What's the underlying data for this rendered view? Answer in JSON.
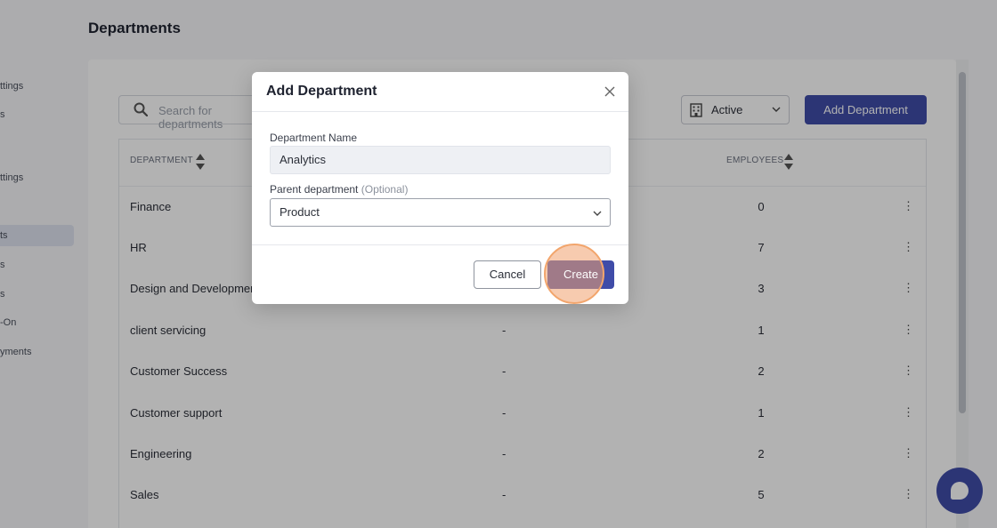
{
  "sidebar": {
    "items": [
      {
        "label": "ttings"
      },
      {
        "label": "s"
      },
      {
        "label": "ttings"
      },
      {
        "label": "ts"
      },
      {
        "label": "s"
      },
      {
        "label": "s"
      },
      {
        "label": "-On"
      },
      {
        "label": "yments"
      }
    ]
  },
  "page": {
    "title": "Departments"
  },
  "toolbar": {
    "search_placeholder": "Search for departments",
    "status_value": "Active",
    "add_label": "Add Department"
  },
  "table": {
    "headers": {
      "department": "DEPARTMENT",
      "employees": "EMPLOYEES"
    },
    "rows": [
      {
        "name": "Finance",
        "parent": "",
        "employees": "0"
      },
      {
        "name": "HR",
        "parent": "",
        "employees": "7"
      },
      {
        "name": "Design and Development",
        "parent": "",
        "employees": "3"
      },
      {
        "name": "client servicing",
        "parent": "-",
        "employees": "1"
      },
      {
        "name": "Customer Success",
        "parent": "-",
        "employees": "2"
      },
      {
        "name": "Customer support",
        "parent": "-",
        "employees": "1"
      },
      {
        "name": "Engineering",
        "parent": "-",
        "employees": "2"
      },
      {
        "name": "Sales",
        "parent": "-",
        "employees": "5"
      }
    ],
    "kebab": "⋮"
  },
  "modal": {
    "title": "Add Department",
    "name_label": "Department Name",
    "name_value": "Analytics",
    "parent_label": "Parent department",
    "parent_optional": "(Optional)",
    "parent_value": "Product",
    "cancel_label": "Cancel",
    "create_label": "Create"
  },
  "colors": {
    "accent": "#3f4ca8",
    "click_highlight": "#f2a56c"
  },
  "icons": [
    "search-icon",
    "building-icon",
    "chevron-down-icon",
    "sort-icon",
    "kebab-icon",
    "close-icon",
    "chat-icon"
  ]
}
